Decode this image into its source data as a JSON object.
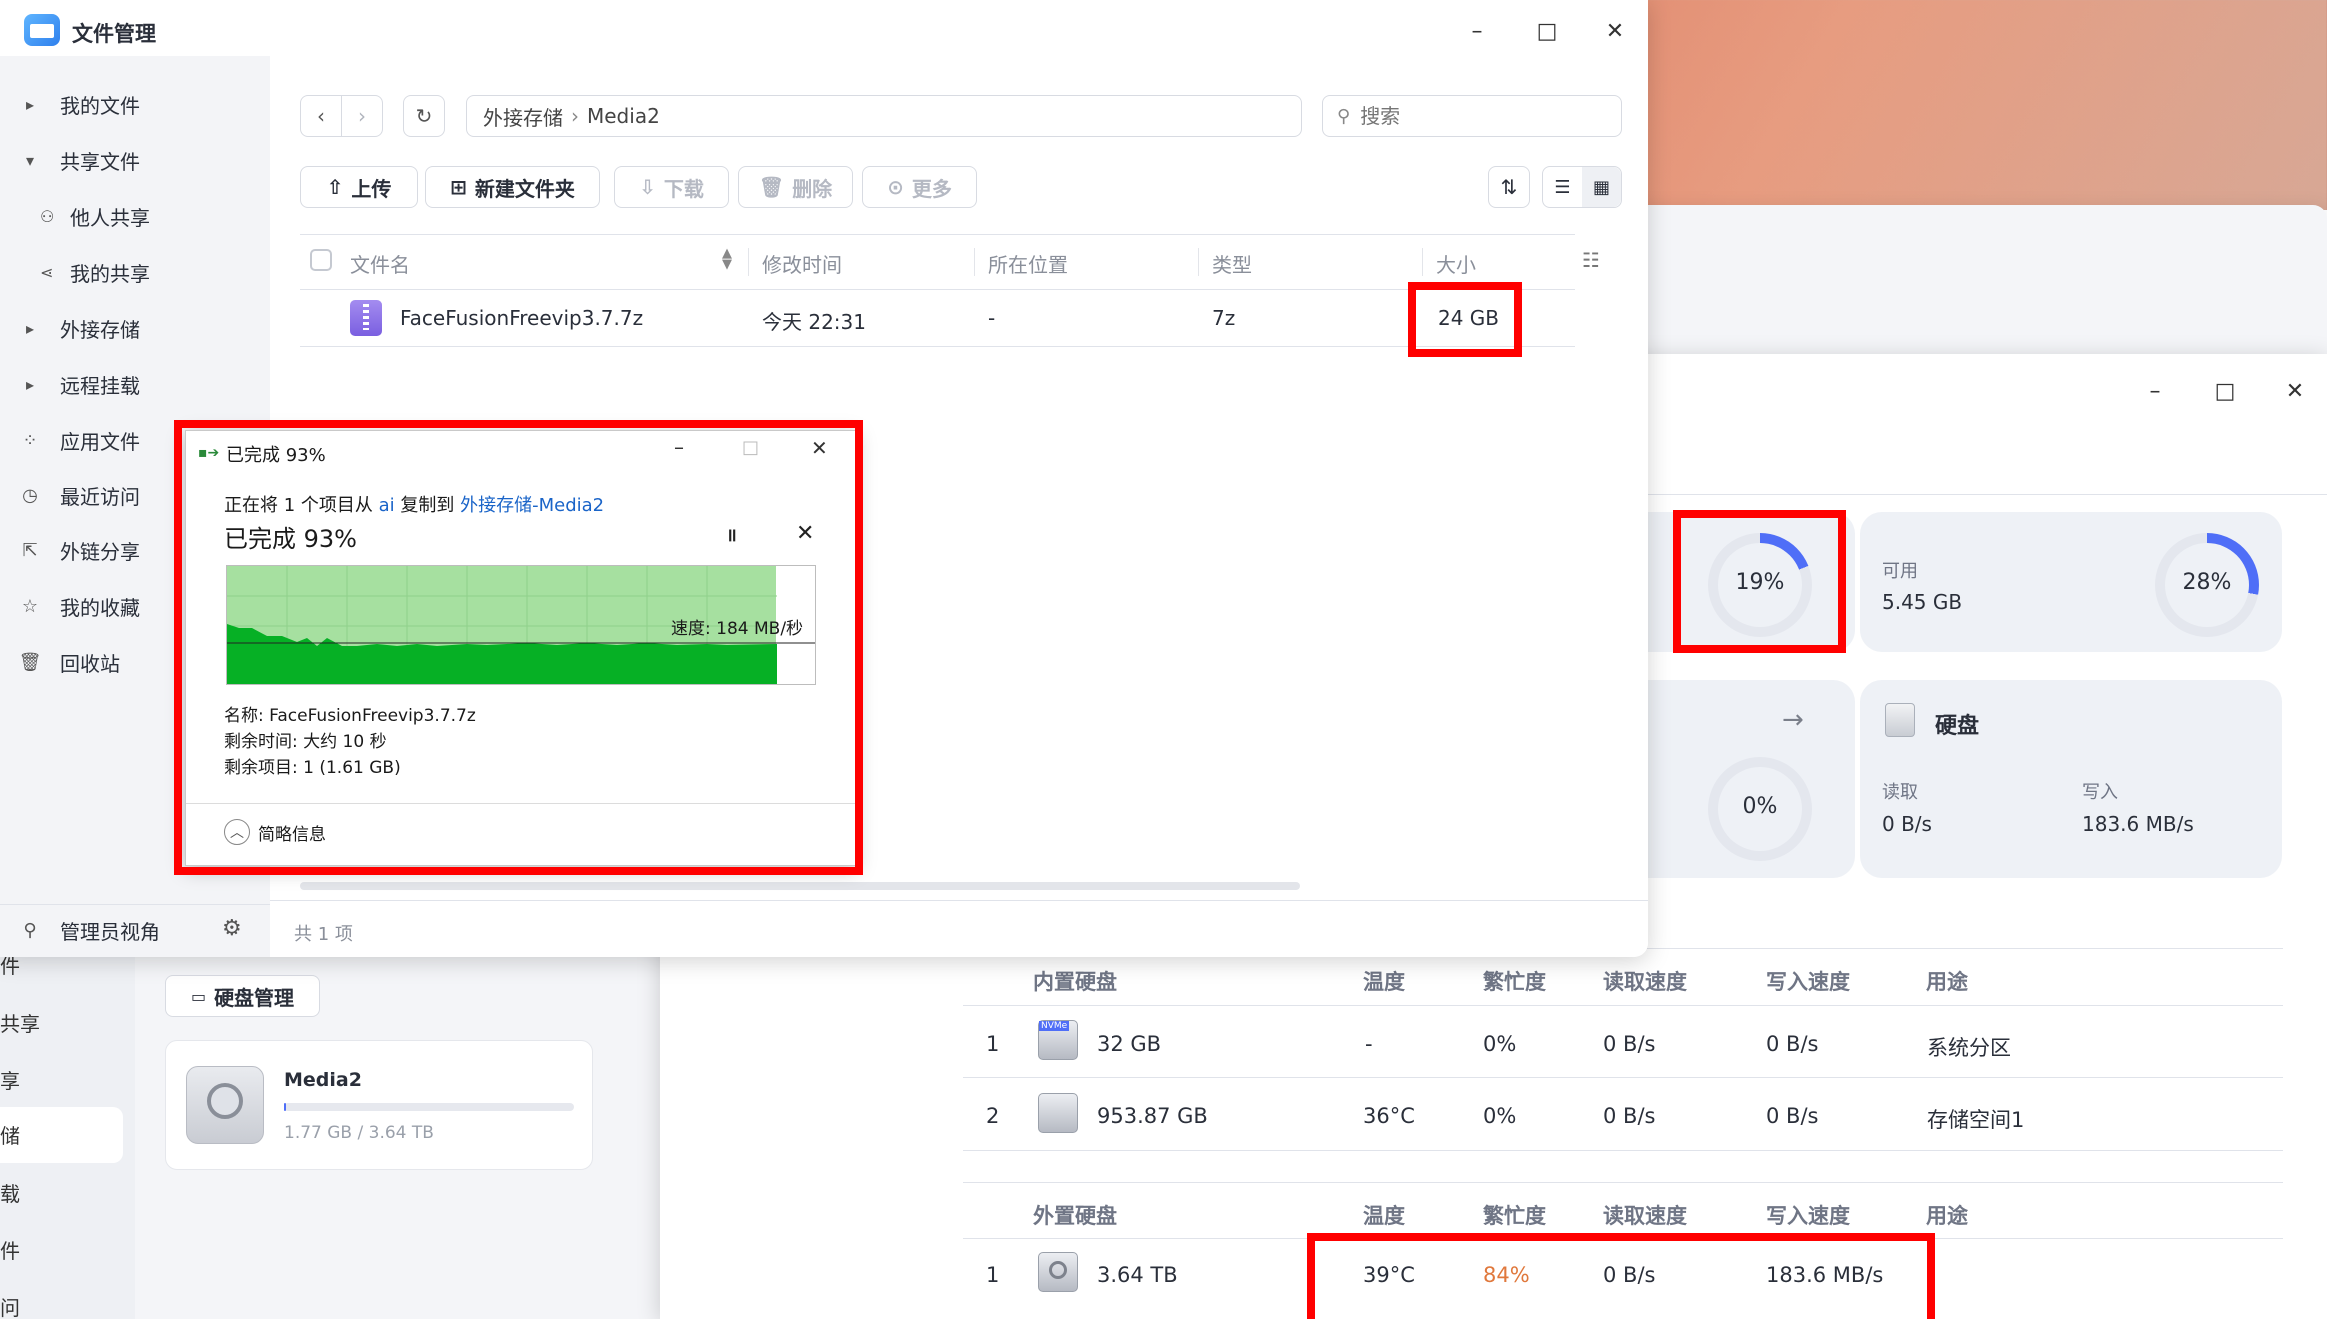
{
  "file_manager": {
    "title": "文件管理",
    "sidebar": [
      {
        "label": "我的文件",
        "icon": "caret-right-icon"
      },
      {
        "label": "共享文件",
        "icon": "caret-down-icon"
      },
      {
        "label": "他人共享",
        "icon": "users-icon"
      },
      {
        "label": "我的共享",
        "icon": "share-icon"
      },
      {
        "label": "外接存储",
        "icon": "caret-right-icon"
      },
      {
        "label": "远程挂载",
        "icon": "caret-right-icon"
      },
      {
        "label": "应用文件",
        "icon": "apps-icon"
      },
      {
        "label": "最近访问",
        "icon": "clock-icon"
      },
      {
        "label": "外链分享",
        "icon": "link-share-icon"
      },
      {
        "label": "我的收藏",
        "icon": "star-icon"
      },
      {
        "label": "回收站",
        "icon": "trash-icon"
      }
    ],
    "admin_view": "管理员视角",
    "breadcrumb": [
      "外接存储",
      "Media2"
    ],
    "search_placeholder": "搜索",
    "toolbar": {
      "upload": "上传",
      "new_folder": "新建文件夹",
      "download": "下载",
      "delete": "删除",
      "more": "更多"
    },
    "columns": {
      "name": "文件名",
      "modified": "修改时间",
      "location": "所在位置",
      "type": "类型",
      "size": "大小"
    },
    "rows": [
      {
        "name": "FaceFusionFreevip3.7.7z",
        "modified": "今天 22:31",
        "location": "-",
        "type": "7z",
        "size": "24 GB"
      }
    ],
    "footer": "共 1 项"
  },
  "copy_dialog": {
    "title": "已完成 93%",
    "line_prefix": "正在将 1 个项目从 ",
    "from": "ai",
    "mid": " 复制到 ",
    "to": "外接存储-Media2",
    "progress_label": "已完成 93%",
    "progress": 0.93,
    "speed": "速度: 184 MB/秒",
    "name_line": "名称: FaceFusionFreevip3.7.7z",
    "time_line": "剩余时间: 大约 10 秒",
    "items_line": "剩余项目: 1 (1.61 GB)",
    "details": "简略信息"
  },
  "storage": {
    "nav_fragments": [
      "件",
      "共享",
      "享",
      "储",
      "载",
      "件",
      "问"
    ],
    "disk_mgmt_button": "硬盘管理",
    "disk_name": "Media2",
    "disk_usage": "1.77 GB / 3.64 TB",
    "disk_usage_fraction": 0.0005,
    "cpu_pct": "19%",
    "cpu_frac": 0.19,
    "mem_label": "可用",
    "mem_value": "5.45 GB",
    "mem_pct": "28%",
    "mem_frac": 0.28,
    "net_pct": "0%",
    "disk_title": "硬盘",
    "read_label": "读取",
    "read_value": "0 B/s",
    "write_label": "写入",
    "write_value": "183.6 MB/s",
    "internal": {
      "headers": [
        "内置硬盘",
        "温度",
        "繁忙度",
        "读取速度",
        "写入速度",
        "用途"
      ],
      "rows": [
        {
          "n": "1",
          "size": "32 GB",
          "temp": "-",
          "busy": "0%",
          "read": "0 B/s",
          "write": "0 B/s",
          "use": "系统分区"
        },
        {
          "n": "2",
          "size": "953.87 GB",
          "temp": "36°C",
          "busy": "0%",
          "read": "0 B/s",
          "write": "0 B/s",
          "use": "存储空间1"
        }
      ]
    },
    "external": {
      "headers": [
        "外置硬盘",
        "温度",
        "繁忙度",
        "读取速度",
        "写入速度",
        "用途"
      ],
      "rows": [
        {
          "n": "1",
          "size": "3.64 TB",
          "temp": "39°C",
          "busy": "84%",
          "read": "0 B/s",
          "write": "183.6 MB/s"
        }
      ]
    }
  },
  "colors": {
    "accent": "#4f6ef7",
    "busy_warn": "#e0783c",
    "highlight": "#ff0000",
    "copy_green": "#06b025"
  }
}
